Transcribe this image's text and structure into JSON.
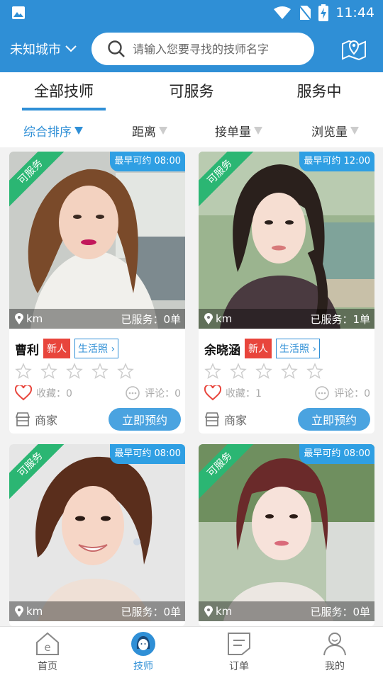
{
  "status_bar": {
    "time": "11:44"
  },
  "header": {
    "city": "未知城市",
    "search_placeholder": "请输入您要寻找的技师名字"
  },
  "tabs": [
    {
      "label": "全部技师",
      "active": true
    },
    {
      "label": "可服务",
      "active": false
    },
    {
      "label": "服务中",
      "active": false
    }
  ],
  "sort_options": [
    {
      "label": "综合排序",
      "active": true
    },
    {
      "label": "距离",
      "active": false
    },
    {
      "label": "接单量",
      "active": false
    },
    {
      "label": "浏览量",
      "active": false
    }
  ],
  "cards": [
    {
      "status_ribbon": "可服务",
      "earliest": "最早可约 08:00",
      "distance": "km",
      "served": "已服务：0单",
      "name": "曹利",
      "badge_new": "新人",
      "badge_life": "生活照",
      "rating": 0,
      "favorites": "收藏：0",
      "comments": "评论：0",
      "merchant": "商家",
      "book": "立即预约"
    },
    {
      "status_ribbon": "可服务",
      "earliest": "最早可约 12:00",
      "distance": "km",
      "served": "已服务：1单",
      "name": "余晓涵",
      "badge_new": "新人",
      "badge_life": "生活照",
      "rating": 0,
      "favorites": "收藏：1",
      "comments": "评论：0",
      "merchant": "商家",
      "book": "立即预约"
    },
    {
      "status_ribbon": "可服务",
      "earliest": "最早可约 08:00",
      "distance": "km",
      "served": "已服务：0单"
    },
    {
      "status_ribbon": "可服务",
      "earliest": "最早可约 08:00",
      "distance": "km",
      "served": "已服务：0单"
    }
  ],
  "nav": [
    {
      "label": "首页",
      "icon": "home-icon",
      "active": false
    },
    {
      "label": "技师",
      "icon": "technician-icon",
      "active": true
    },
    {
      "label": "订单",
      "icon": "order-icon",
      "active": false
    },
    {
      "label": "我的",
      "icon": "profile-icon",
      "active": false
    }
  ],
  "colors": {
    "primary": "#2f8fd6",
    "available": "#2bb673",
    "new_badge": "#e8453c"
  }
}
